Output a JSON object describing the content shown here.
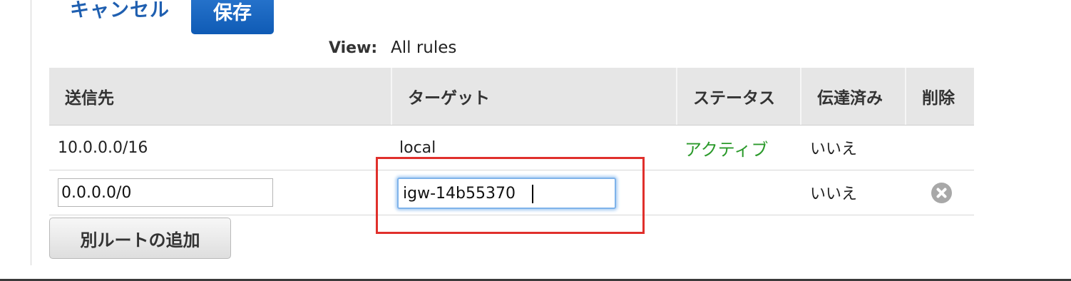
{
  "actions": {
    "cancel_label": "キャンセル",
    "save_label": "保存"
  },
  "view": {
    "label": "View:",
    "value": "All rules"
  },
  "table": {
    "headers": {
      "destination": "送信先",
      "target": "ターゲット",
      "status": "ステータス",
      "propagated": "伝達済み",
      "delete": "削除"
    },
    "rows": [
      {
        "destination": "10.0.0.0/16",
        "target": "local",
        "status": "アクティブ",
        "propagated": "いいえ"
      },
      {
        "destination": "0.0.0.0/0",
        "target": "igw-14b55370",
        "status": "",
        "propagated": "いいえ",
        "delete_icon": "remove-circle-icon"
      }
    ]
  },
  "add_route_label": "別ルートの追加",
  "colors": {
    "primary_button": "#1a64bd",
    "active_status": "#2b9a2b",
    "highlight": "#e0302c",
    "focus_ring": "#7fb3ea"
  }
}
